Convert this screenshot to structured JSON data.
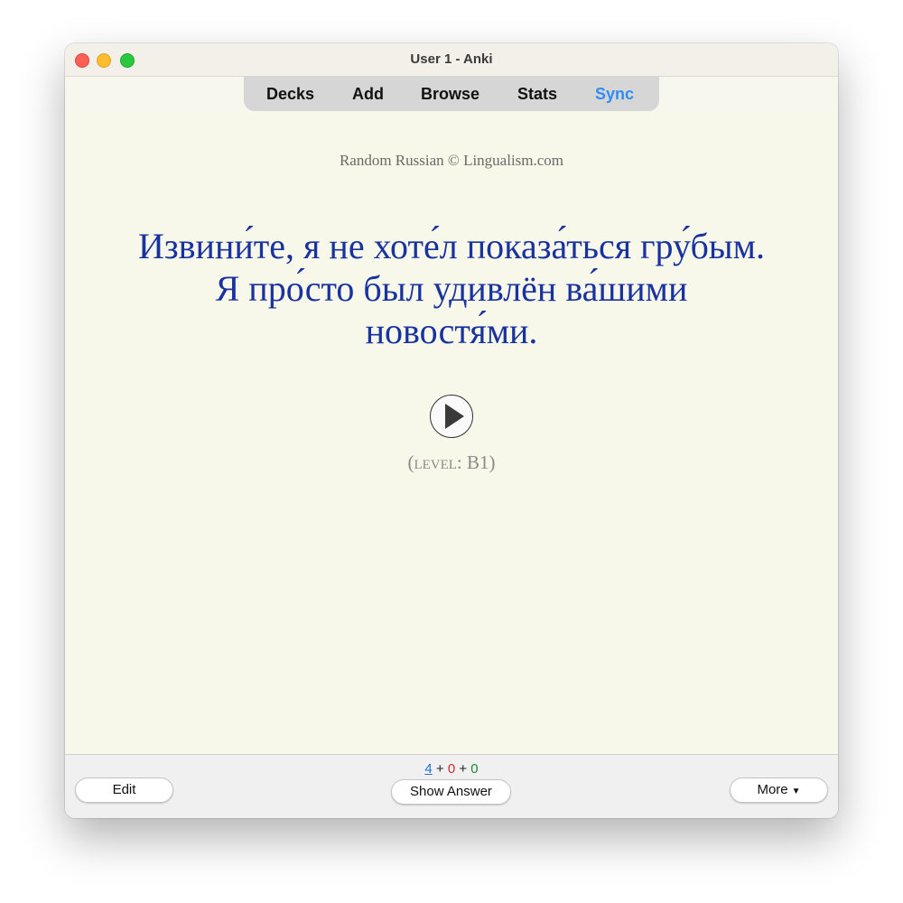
{
  "window": {
    "title": "User 1 - Anki"
  },
  "toolbar": {
    "decks": "Decks",
    "add": "Add",
    "browse": "Browse",
    "stats": "Stats",
    "sync": "Sync",
    "sync_color": "#2f8cf2"
  },
  "card": {
    "source": "Random Russian © Lingualism.com",
    "sentence_line1": "Извини́те, я не хоте́л показа́ться гру́бым.",
    "sentence_line2": "Я про́сто был удивлён ва́шими",
    "sentence_line3": "новостя́ми.",
    "sentence_color": "#19339e",
    "play_icon": "play-audio-icon",
    "level_open": "(",
    "level_label": "level:",
    "level_value": " B1",
    "level_close": ")"
  },
  "bottom": {
    "count_new": "4",
    "plus1": " + ",
    "count_learn": "0",
    "plus2": " + ",
    "count_review": "0",
    "edit_label": "Edit",
    "show_answer_label": "Show Answer",
    "more_label": "More",
    "more_caret_icon": "chevron-down-icon"
  }
}
